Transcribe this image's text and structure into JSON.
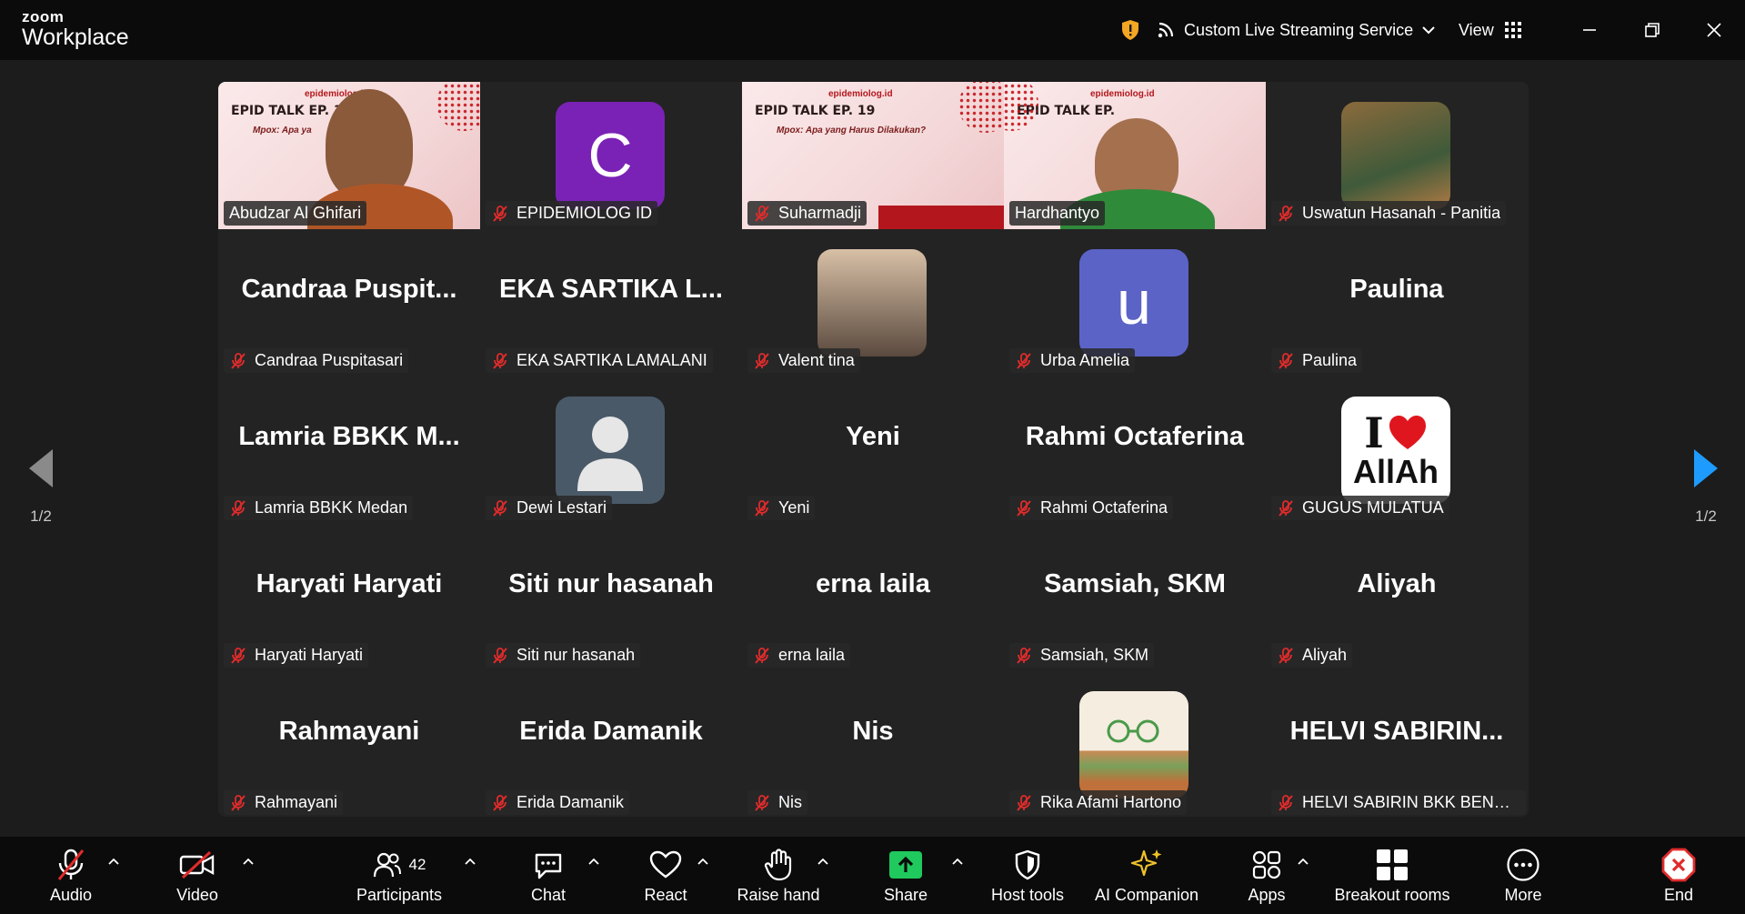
{
  "app": {
    "logo_top": "zoom",
    "logo_bottom": "Workplace"
  },
  "titlebar": {
    "stream_label": "Custom Live Streaming Service",
    "view_label": "View"
  },
  "colors": {
    "active_speaker": "#2ed17a",
    "mute_red": "#e02b2b",
    "share_green": "#1fc95d",
    "nav_blue": "#1e9bff"
  },
  "participants_count": "42",
  "tiles": [
    {
      "name": "Abudzar Al Ghifari"
    },
    {
      "name": "EPIDEMIOLOG ID",
      "avatar_letter": "C"
    },
    {
      "name": "Suharmadji",
      "slide_title": "EPID TALK EP. 19",
      "slide_sub": "Mpox: Apa yang Harus Dilakukan?",
      "slide_logo": "epidemiolog.id"
    },
    {
      "name": "Hardhantyo",
      "slide_title": "EPID TALK EP.",
      "slide_logo": "epidemiolog.id"
    },
    {
      "name": "Uswatun Hasanah - Panitia"
    },
    {
      "big": "Candraa  Puspit...",
      "name": "Candraa Puspitasari"
    },
    {
      "big": "EKA  SARTIKA  L...",
      "name": "EKA SARTIKA LAMALANI"
    },
    {
      "name": "Valent tina"
    },
    {
      "name": "Urba Amelia",
      "avatar_letter": "u"
    },
    {
      "big": "Paulina",
      "name": "Paulina"
    },
    {
      "big": "Lamria  BBKK  M...",
      "name": "Lamria BBKK Medan"
    },
    {
      "name": "Dewi Lestari"
    },
    {
      "big": "Yeni",
      "name": "Yeni"
    },
    {
      "big": "Rahmi Octaferina",
      "name": "Rahmi Octaferina"
    },
    {
      "name": "GUGUS MULATUA",
      "avatar_text": "AllAh"
    },
    {
      "big": "Haryati  Haryati",
      "name": "Haryati  Haryati"
    },
    {
      "big": "Siti nur hasanah",
      "name": "Siti nur hasanah"
    },
    {
      "big": "erna laila",
      "name": "erna laila"
    },
    {
      "big": "Samsiah, SKM",
      "name": "Samsiah, SKM"
    },
    {
      "big": "Aliyah",
      "name": "Aliyah"
    },
    {
      "big": "Rahmayani",
      "name": "Rahmayani"
    },
    {
      "big": "Erida Damanik",
      "name": "Erida Damanik"
    },
    {
      "big": "Nis",
      "name": "Nis"
    },
    {
      "name": "Rika Afami Hartono"
    },
    {
      "big": "HELVI  SABIRIN...",
      "name": "HELVI SABIRIN BKK BENGKU..."
    }
  ],
  "tile0_slide": {
    "title": "EPID TALK EP. 1",
    "sub": "Mpox: Apa ya"
  },
  "pager": {
    "left": "1/2",
    "right": "1/2"
  },
  "toolbar": {
    "audio": "Audio",
    "video": "Video",
    "participants": "Participants",
    "chat": "Chat",
    "react": "React",
    "raise_hand": "Raise hand",
    "share": "Share",
    "host_tools": "Host tools",
    "ai_companion": "AI Companion",
    "apps": "Apps",
    "breakout_rooms": "Breakout rooms",
    "more": "More",
    "end": "End"
  }
}
